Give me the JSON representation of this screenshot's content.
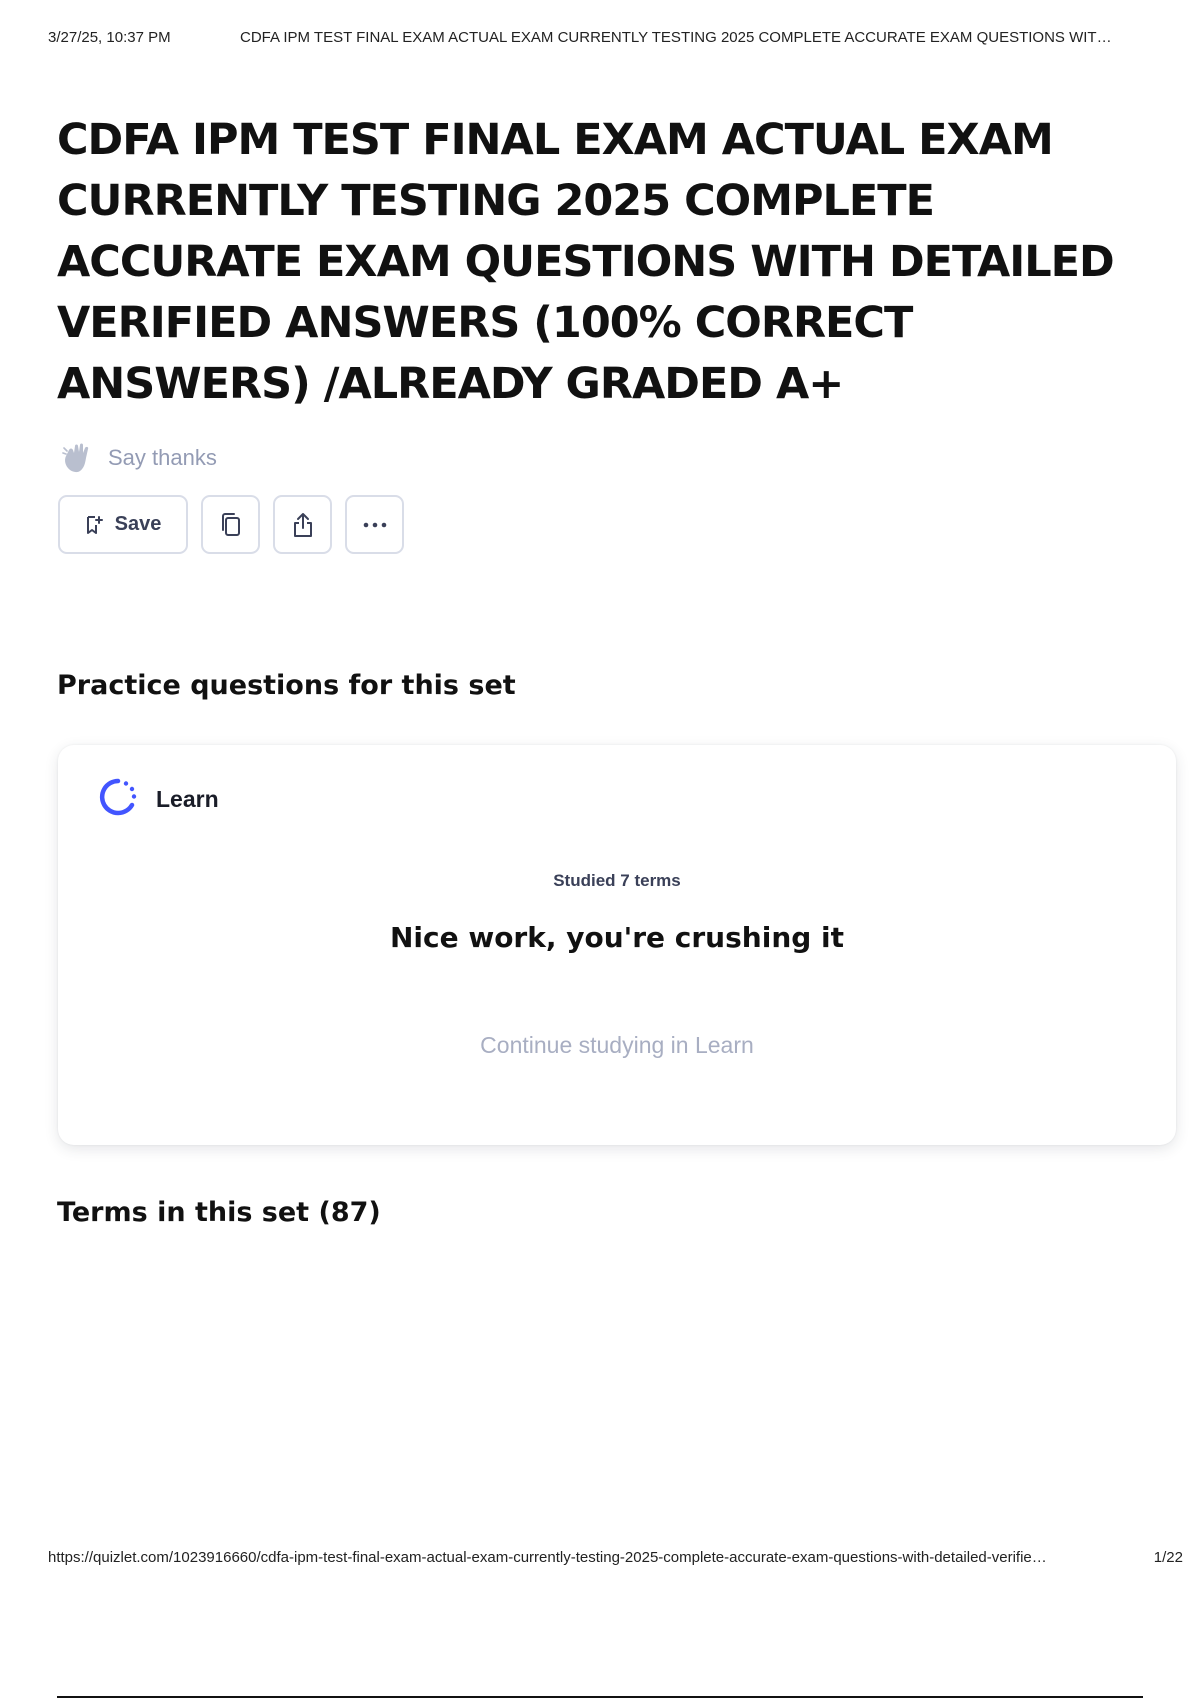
{
  "print_header": {
    "date": "3/27/25, 10:37 PM",
    "doc_title": "CDFA IPM TEST FINAL EXAM ACTUAL EXAM CURRENTLY TESTING 2025 COMPLETE ACCURATE EXAM QUESTIONS WIT…"
  },
  "page": {
    "title": "CDFA IPM TEST FINAL EXAM ACTUAL EXAM CURRENTLY TESTING 2025 COMPLETE ACCURATE EXAM QUESTIONS WITH DETAILED VERIFIED ANSWERS (100% CORRECT ANSWERS) /ALREADY GRADED A+"
  },
  "say_thanks": {
    "label": "Say thanks",
    "icon": "wave-hand-icon"
  },
  "actions": {
    "save_label": "Save",
    "save_icon": "bookmark-add-icon",
    "copy_icon": "copy-icon",
    "share_icon": "share-icon",
    "more_icon": "more-icon"
  },
  "practice": {
    "heading": "Practice questions for this set",
    "card": {
      "mode_label": "Learn",
      "mode_icon": "learn-progress-icon",
      "studied_text": "Studied 7 terms",
      "message": "Nice work, you're crushing it",
      "continue_label": "Continue studying in Learn"
    }
  },
  "terms": {
    "heading": "Terms in this set (87)"
  },
  "print_footer": {
    "url": "https://quizlet.com/1023916660/cdfa-ipm-test-final-exam-actual-exam-currently-testing-2025-complete-accurate-exam-questions-with-detailed-verifie…",
    "page_number": "1/22"
  },
  "colors": {
    "accent": "#4255ff",
    "muted_text": "#939bb4",
    "button_border": "#d9dde8",
    "link_muted": "#a8aec2"
  }
}
